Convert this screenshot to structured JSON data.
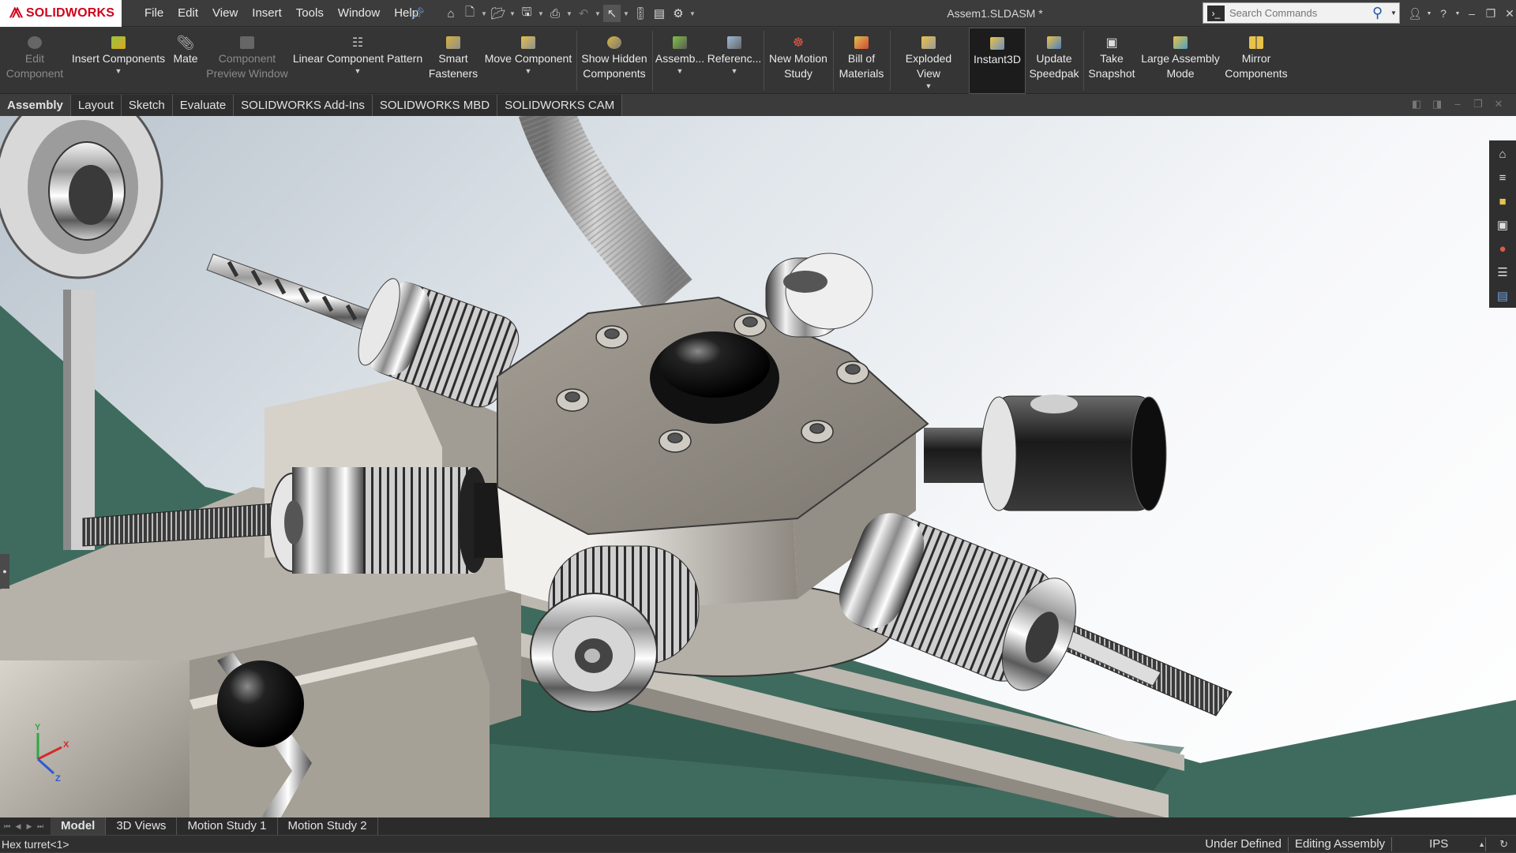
{
  "app": {
    "brand": "SOLIDWORKS",
    "document_title": "Assem1.SLDASM *"
  },
  "menu": [
    "File",
    "Edit",
    "View",
    "Insert",
    "Tools",
    "Window",
    "Help"
  ],
  "quick_access": [
    "pin-icon",
    "home-icon",
    "new-document-icon",
    "open-icon",
    "save-icon",
    "print-icon",
    "undo-icon",
    "select-icon",
    "rebuild-icon",
    "file-properties-icon",
    "options-icon"
  ],
  "search": {
    "placeholder": "Search Commands"
  },
  "command_manager": {
    "buttons": [
      {
        "label": "Edit\nComponent",
        "icon": "edit-component-icon",
        "enabled": false
      },
      {
        "label": "Insert Components",
        "icon": "insert-components-icon",
        "enabled": true
      },
      {
        "label": "Mate",
        "icon": "mate-icon",
        "enabled": true
      },
      {
        "label": "Component\nPreview Window",
        "icon": "component-preview-icon",
        "enabled": false
      },
      {
        "label": "Linear Component Pattern",
        "icon": "linear-pattern-icon",
        "enabled": true
      },
      {
        "label": "Smart\nFasteners",
        "icon": "smart-fasteners-icon",
        "enabled": true
      },
      {
        "label": "Move Component",
        "icon": "move-component-icon",
        "enabled": true
      },
      {
        "label": "Show Hidden\nComponents",
        "icon": "show-hidden-icon",
        "enabled": true
      },
      {
        "label": "Assemb...",
        "icon": "assembly-features-icon",
        "enabled": true
      },
      {
        "label": "Referenc...",
        "icon": "reference-geometry-icon",
        "enabled": true
      },
      {
        "label": "New Motion\nStudy",
        "icon": "motion-study-icon",
        "enabled": true
      },
      {
        "label": "Bill of\nMaterials",
        "icon": "bom-icon",
        "enabled": true
      },
      {
        "label": "Exploded View",
        "icon": "exploded-view-icon",
        "enabled": true
      },
      {
        "label": "Instant3D",
        "icon": "instant3d-icon",
        "enabled": true,
        "active": true
      },
      {
        "label": "Update\nSpeedpak",
        "icon": "speedpak-icon",
        "enabled": true
      },
      {
        "label": "Take\nSnapshot",
        "icon": "camera-icon",
        "enabled": true
      },
      {
        "label": "Large Assembly\nMode",
        "icon": "large-assembly-icon",
        "enabled": true
      },
      {
        "label": "Mirror\nComponents",
        "icon": "mirror-components-icon",
        "enabled": true
      }
    ]
  },
  "tabs": [
    "Assembly",
    "Layout",
    "Sketch",
    "Evaluate",
    "SOLIDWORKS Add-Ins",
    "SOLIDWORKS MBD",
    "SOLIDWORKS CAM"
  ],
  "active_tab": "Assembly",
  "task_pane": [
    "home-icon",
    "design-library-icon",
    "file-explorer-icon",
    "view-palette-icon",
    "appearances-icon",
    "custom-properties-icon",
    "forum-icon"
  ],
  "bottom_tabs": [
    "Model",
    "3D Views",
    "Motion Study 1",
    "Motion Study 2"
  ],
  "active_bottom_tab": "Model",
  "status": {
    "selection": "Hex turret<1>",
    "definition": "Under Defined",
    "mode": "Editing Assembly",
    "units": "IPS"
  },
  "triad": {
    "x": "X",
    "y": "Y",
    "z": "Z"
  },
  "colors": {
    "brand_red": "#d0021b",
    "bed_green": "#3f6b5e",
    "steel": "#8c877f",
    "chrome": "#d9d9d9"
  }
}
